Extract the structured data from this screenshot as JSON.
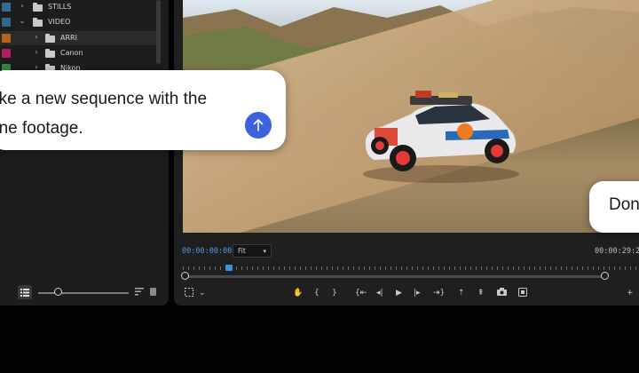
{
  "project_panel": {
    "items": [
      {
        "label": "STILLS",
        "swatch": "#2f6f96",
        "expanded": false
      },
      {
        "label": "VIDEO",
        "swatch": "#2a6a8c",
        "expanded": true
      },
      {
        "label": "ARRI",
        "swatch": "#b5631c",
        "expanded": false
      },
      {
        "label": "Canon",
        "swatch": "#b01e64",
        "expanded": false
      },
      {
        "label": "Nikon",
        "swatch": "#2f8a3a",
        "expanded": false
      }
    ]
  },
  "monitor": {
    "timecode_current": "00:00:00:00",
    "fit_value": "Fit",
    "timecode_duration": "00:00:29:2"
  },
  "chat": {
    "prompt_line1": "ake a new sequence with the",
    "prompt_line2": "one footage.",
    "reply_text": "Don"
  },
  "colors": {
    "accent_blue": "#3b63e0",
    "timecode_blue": "#4f9ae6",
    "panel_bg": "#1d1d1d"
  }
}
